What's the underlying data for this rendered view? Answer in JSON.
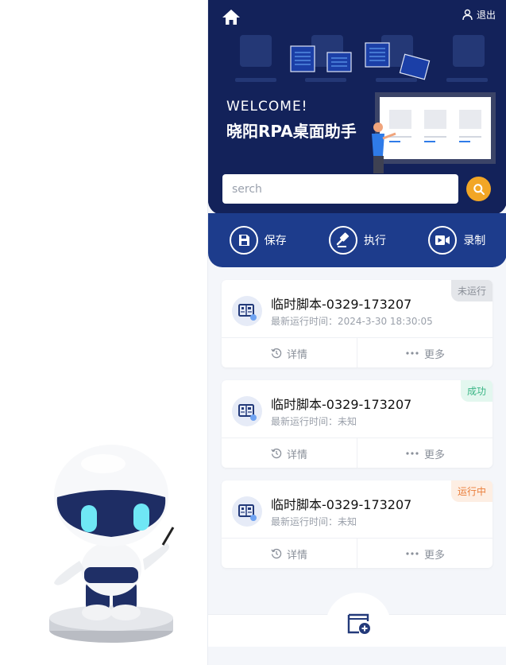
{
  "colors": {
    "hero_bg": "#13225a",
    "actions_bg": "#1d3c8c",
    "accent_orange": "#f2a626",
    "icon_blue": "#233a7a"
  },
  "header": {
    "logout_label": "退出",
    "welcome": "WELCOME!",
    "title": "晓阳RPA桌面助手"
  },
  "search": {
    "placeholder": "serch"
  },
  "actions": [
    {
      "label": "保存",
      "icon": "save-icon"
    },
    {
      "label": "执行",
      "icon": "gavel-icon"
    },
    {
      "label": "录制",
      "icon": "record-video-icon"
    }
  ],
  "scripts": [
    {
      "title": "临时脚本-0329-173207",
      "last_run_label": "最新运行时间：2024-3-30 18:30:05",
      "status": "未运行",
      "status_color": "#8a8f98",
      "status_bg": "#e4e6ea",
      "detail_label": "详情",
      "more_label": "更多"
    },
    {
      "title": "临时脚本-0329-173207",
      "last_run_label": "最新运行时间：未知",
      "status": "成功",
      "status_color": "#3ab585",
      "status_bg": "#e3f7ef",
      "detail_label": "详情",
      "more_label": "更多"
    },
    {
      "title": "临时脚本-0329-173207",
      "last_run_label": "最新运行时间：未知",
      "status": "运行中",
      "status_color": "#ea7e3a",
      "status_bg": "#fdeee3",
      "detail_label": "详情",
      "more_label": "更多"
    }
  ]
}
